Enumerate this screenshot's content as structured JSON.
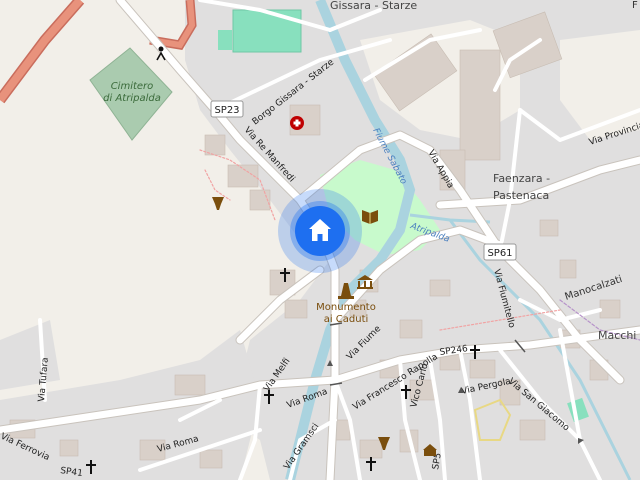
{
  "map": {
    "places": {
      "gissara": "Gissara - Starze",
      "faenzara_line1": "Faenzara -",
      "faenzara_line2": "Pastenaca",
      "macchia": "Macchi",
      "manocalzati": "Manocalzati",
      "atripalda": "Atripalda"
    },
    "cemetery": {
      "line1": "Cimitero",
      "line2": "di Atripalda"
    },
    "monument": {
      "line1": "Monumento",
      "line2": "ai Caduti"
    },
    "water": {
      "river": "Fiume Sabato"
    },
    "roads": {
      "borgo": "Borgo Gissara - Starze",
      "re_manfredi": "Via Re Manfredi",
      "appia": "Via Appia",
      "provinciale": "Via Provinciale",
      "fiumitello": "Via Fiumitello",
      "fiume": "Via Fiume",
      "rapolla": "Via Francesco Rapolla",
      "carlo": "Vico Carlo",
      "pergola": "Via Pergola",
      "san_giacomo": "Via San Giacomo",
      "melfi": "Via Melfi",
      "roma1": "Via Roma",
      "roma2": "Via Roma",
      "tufara": "Via Tufara",
      "ferrovia": "Via Ferrovia",
      "gramsci": "Via Gramsci",
      "sp5": "SP5",
      "sp246": "SP246",
      "sp41": "SP41"
    },
    "shields": {
      "sp23": "SP23",
      "sp61": "SP61"
    },
    "partial_top_right": "F",
    "colors": {
      "background": "#f2efe9",
      "residential": "#e0dfdf",
      "building": "#d9d0c9",
      "park": "#c8facc",
      "pitch": "#88e0be",
      "cemetery": "#aacbaf",
      "water": "#aad3df",
      "motorway": "#e8927c",
      "marker": "#1e6ff0"
    },
    "icons": [
      "home-marker-icon",
      "hospital-icon",
      "library-icon",
      "museum-icon",
      "memorial-icon",
      "church-icon",
      "archaeological-icon",
      "playground-icon"
    ]
  }
}
